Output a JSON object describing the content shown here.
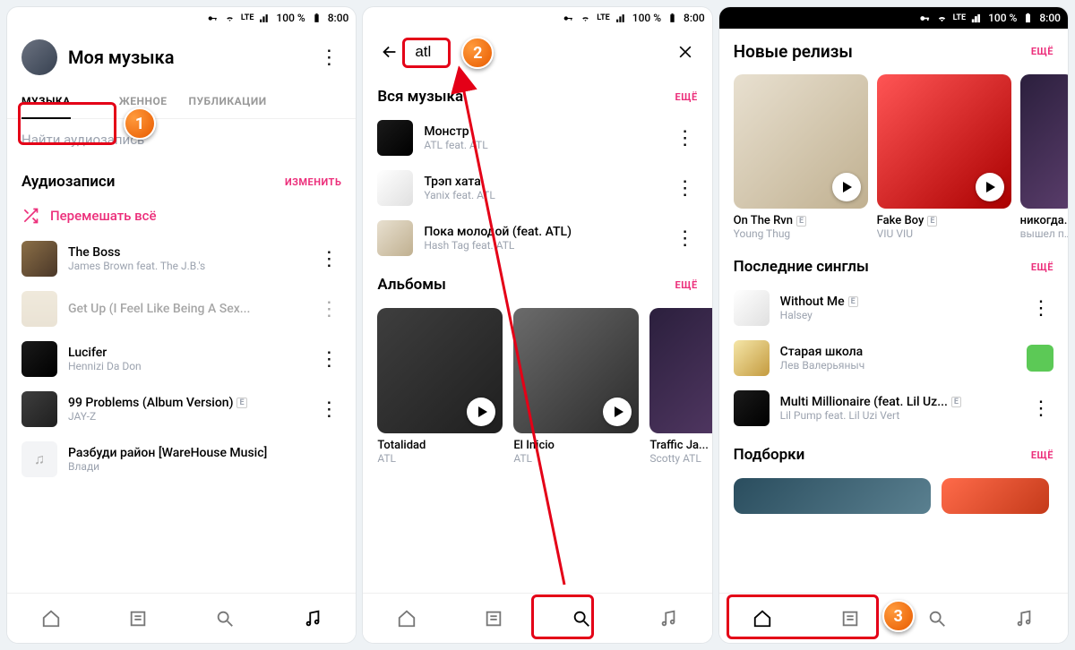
{
  "status": {
    "lte": "LTE",
    "battery": "100 %",
    "time": "8:00"
  },
  "screen1": {
    "title": "Моя музыка",
    "tabs": {
      "music": "МУЗЫКА",
      "loaded": "ЖЕННОЕ",
      "pubs": "ПУБЛИКАЦИИ"
    },
    "search_ph": "Найти аудиозапись",
    "audio_section": "Аудиозаписи",
    "edit": "ИЗМЕНИТЬ",
    "shuffle": "Перемешать всё",
    "tracks": [
      {
        "name": "The Boss",
        "artist": "James Brown feat. The J.B.'s"
      },
      {
        "name": "Get Up (I Feel Like Being A Sex...",
        "artist": ""
      },
      {
        "name": "Lucifer",
        "artist": "Hennizi Da Don"
      },
      {
        "name": "99 Problems (Album Version)",
        "artist": "JAY-Z",
        "e": true
      },
      {
        "name": "Разбуди район [WareHouse Music]",
        "artist": "Влади"
      }
    ]
  },
  "screen2": {
    "query": "atl",
    "all_music": "Вся музыка",
    "more": "ЕЩЁ",
    "tracks": [
      {
        "name": "Монстр",
        "artist": "ATL feat. ATL"
      },
      {
        "name": "Трэп хата",
        "artist": "Yanix feat. ATL"
      },
      {
        "name": "Пока молодой (feat. ATL)",
        "artist": "Hash Tag feat. ATL"
      }
    ],
    "albums_section": "Альбомы",
    "albums": [
      {
        "name": "Totalidad",
        "artist": "ATL"
      },
      {
        "name": "El Inicio",
        "artist": "ATL"
      },
      {
        "name": "Traffic Ja...",
        "artist": "Scotty ATL"
      }
    ]
  },
  "screen3": {
    "releases": "Новые релизы",
    "more": "ЕЩЁ",
    "rels": [
      {
        "name": "On The Rvn",
        "artist": "Young Thug",
        "e": true
      },
      {
        "name": "Fake Boy",
        "artist": "VIU VIU",
        "e": true
      },
      {
        "name": "никогда...",
        "artist": "вышел по..."
      }
    ],
    "singles": "Последние синглы",
    "singles_list": [
      {
        "name": "Without Me",
        "artist": "Halsey",
        "e": true
      },
      {
        "name": "Старая школа",
        "artist": "Лев Валерьяныч"
      },
      {
        "name": "Multi Millionaire (feat. Lil Uz...",
        "artist": "Lil Pump feat. Lil Uzi Vert",
        "e": true
      }
    ],
    "collections": "Подборки"
  },
  "annotations": {
    "n1": "1",
    "n2": "2",
    "n3": "3"
  }
}
